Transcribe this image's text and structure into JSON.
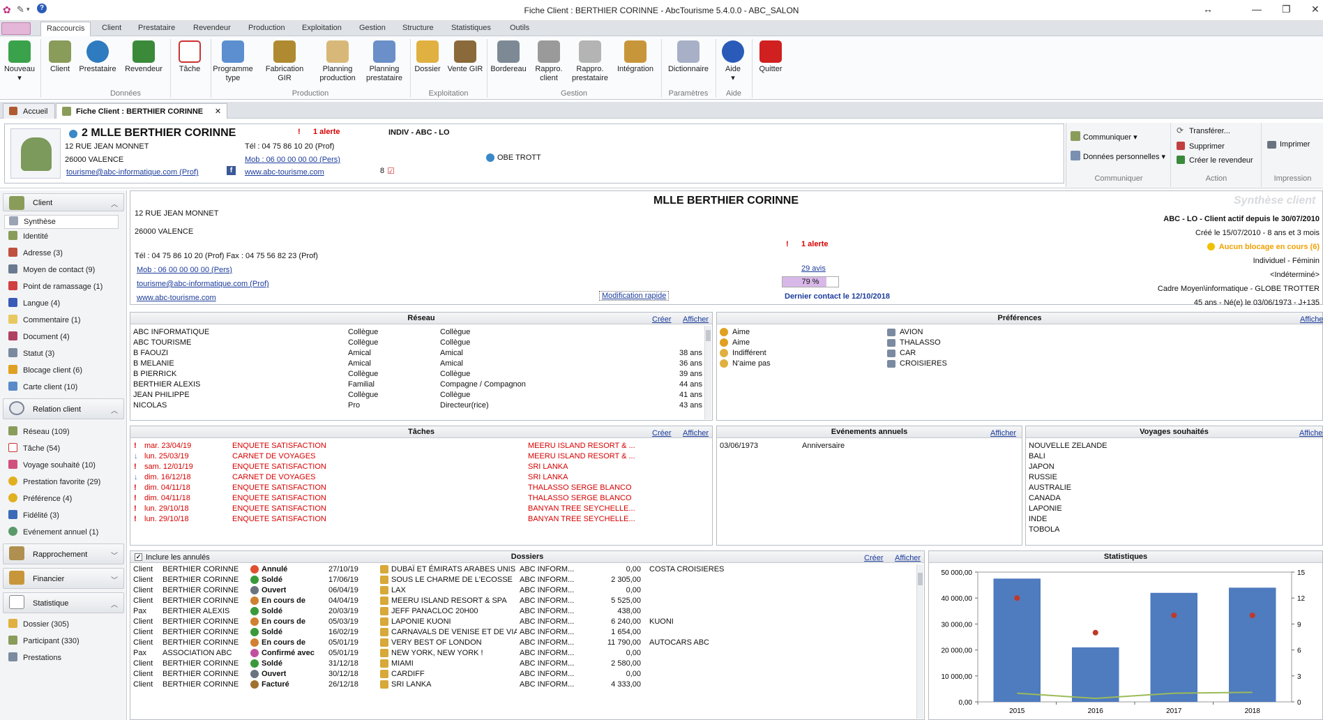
{
  "window": {
    "title": "Fiche Client : BERTHIER CORINNE - AbcTourisme 5.4.0.0 - ABC_SALON"
  },
  "ribbon_tabs": [
    "Raccourcis",
    "Client",
    "Prestataire",
    "Revendeur",
    "Production",
    "Exploitation",
    "Gestion",
    "Structure",
    "Statistiques",
    "Outils"
  ],
  "ribbon": {
    "buttons": [
      "Nouveau",
      "Client",
      "Prestataire",
      "Revendeur",
      "Tâche",
      "Programme type",
      "Fabrication GIR",
      "Planning production",
      "Planning prestataire",
      "Dossier",
      "Vente GIR",
      "Bordereau",
      "Rappro. client",
      "Rappro. prestataire",
      "Intégration",
      "Dictionnaire",
      "Aide",
      "Quitter"
    ],
    "groups": [
      "Données",
      "Production",
      "Exploitation",
      "Gestion",
      "Paramètres",
      "Aide"
    ]
  },
  "doc_tabs": {
    "home": "Accueil",
    "active": "Fiche Client : BERTHIER CORINNE",
    "close": "✕"
  },
  "header": {
    "name": "2 MLLE BERTHIER CORINNE",
    "alert": "1 alerte",
    "category": "INDIV - ABC - LO",
    "address1": "12 RUE JEAN MONNET",
    "address2": "26000 VALENCE",
    "email": "tourisme@abc-informatique.com (Prof)",
    "tel": "Tél : 04 75 86 10 20  (Prof)",
    "mob": "Mob : 06 00 00 00 00  (Pers)",
    "web": "www.abc-tourisme.com",
    "count": "8",
    "globe": "OBE TROTT"
  },
  "right_actions": {
    "communiquer": [
      "Communiquer ▾",
      "Données personnelles ▾"
    ],
    "communiquer_label": "Communiquer",
    "action": [
      "Transférer...",
      "Supprimer",
      "Créer le revendeur"
    ],
    "action_label": "Action",
    "impression": [
      "Imprimer"
    ],
    "impression_label": "Impression"
  },
  "sidebar": {
    "client_head": "Client",
    "client_items": [
      "Synthèse",
      "Identité",
      "Adresse (3)",
      "Moyen de contact (9)",
      "Point de ramassage (1)",
      "Langue (4)",
      "Commentaire (1)",
      "Document (4)",
      "Statut (3)",
      "Blocage client (6)",
      "Carte client (10)"
    ],
    "relation_head": "Relation client",
    "relation_items": [
      "Réseau (109)",
      "Tâche (54)",
      "Voyage souhaité (10)",
      "Prestation favorite (29)",
      "Préférence (4)",
      "Fidélité (3)",
      "Evénement annuel (1)"
    ],
    "rapprochement_head": "Rapprochement",
    "financier_head": "Financier",
    "statistique_head": "Statistique",
    "statistique_items": [
      "Dossier (305)",
      "Participant (330)",
      "Prestations"
    ]
  },
  "synthese": {
    "title": "MLLE BERTHIER CORINNE",
    "watermark": "Synthèse client",
    "addr1": "12 RUE JEAN MONNET",
    "addr2": "26000 VALENCE",
    "telfax": "Tél : 04 75 86 10 20  (Prof)    Fax : 04 75 56 82 23 (Prof)",
    "mob": "Mob : 06 00 00 00 00  (Pers)",
    "email": "tourisme@abc-informatique.com (Prof)",
    "web": "www.abc-tourisme.com",
    "modif": "Modification rapide",
    "alert": "1 alerte",
    "avis": "29 avis",
    "percent": "79 %",
    "percent_value": 79,
    "last_contact": "Dernier contact le 12/10/2018",
    "r1": "ABC - LO - Client actif depuis le 30/07/2010",
    "r2": "Créé le 15/07/2010 - 8 ans  et 3 mois",
    "r3": "Aucun blocage en cours (6)",
    "r4": "Individuel - Féminin",
    "r5": "<Indéterminé>",
    "r6": "Cadre Moyen\\informatique - GLOBE TROTTER",
    "r7": "45 ans - Né(e) le 03/06/1973 -  J+135"
  },
  "reseau": {
    "title": "Réseau",
    "creer": "Créer",
    "afficher": "Afficher",
    "rows": [
      [
        "ABC INFORMATIQUE",
        "Collègue",
        "Collègue",
        ""
      ],
      [
        "ABC TOURISME",
        "Collègue",
        "Collègue",
        ""
      ],
      [
        "B FAOUZI",
        "Amical",
        "Amical",
        "38 ans"
      ],
      [
        "B MELANIE",
        "Amical",
        "Amical",
        "36 ans"
      ],
      [
        "B PIERRICK",
        "Collègue",
        "Collègue",
        "39 ans"
      ],
      [
        "BERTHIER ALEXIS",
        "Familial",
        "Compagne / Compagnon",
        "44 ans"
      ],
      [
        "JEAN PHILIPPE",
        "Collègue",
        "Collègue",
        "41 ans"
      ],
      [
        "NICOLAS",
        "Pro",
        "Directeur(rice)",
        "43 ans"
      ]
    ]
  },
  "preferences": {
    "title": "Préférences",
    "afficher": "Afficher",
    "rows": [
      [
        "Aime",
        "AVION"
      ],
      [
        "Aime",
        "THALASSO"
      ],
      [
        "Indifférent",
        "CAR"
      ],
      [
        "N'aime pas",
        "CROISIERES"
      ]
    ]
  },
  "taches": {
    "title": "Tâches",
    "creer": "Créer",
    "afficher": "Afficher",
    "rows": [
      [
        "mar. 23/04/19",
        "ENQUETE SATISFACTION",
        "MEERU ISLAND RESORT & ..."
      ],
      [
        "lun. 25/03/19",
        "CARNET DE VOYAGES",
        "MEERU ISLAND RESORT & ..."
      ],
      [
        "sam. 12/01/19",
        "ENQUETE SATISFACTION",
        "SRI LANKA"
      ],
      [
        "dim. 16/12/18",
        "CARNET DE VOYAGES",
        "SRI LANKA"
      ],
      [
        "dim. 04/11/18",
        "ENQUETE SATISFACTION",
        "THALASSO SERGE BLANCO"
      ],
      [
        "dim. 04/11/18",
        "ENQUETE SATISFACTION",
        "THALASSO SERGE BLANCO"
      ],
      [
        "lun. 29/10/18",
        "ENQUETE SATISFACTION",
        "BANYAN TREE SEYCHELLE..."
      ],
      [
        "lun. 29/10/18",
        "ENQUETE SATISFACTION",
        "BANYAN TREE SEYCHELLE..."
      ]
    ]
  },
  "evenements": {
    "title": "Evénements annuels",
    "afficher": "Afficher",
    "rows": [
      [
        "03/06/1973",
        "Anniversaire"
      ]
    ]
  },
  "voyages": {
    "title": "Voyages souhaités",
    "afficher": "Afficher",
    "rows": [
      "NOUVELLE ZELANDE",
      "BALI",
      "JAPON",
      "RUSSIE",
      "AUSTRALIE",
      "CANADA",
      "LAPONIE",
      "INDE",
      "TOBOLA"
    ]
  },
  "dossiers": {
    "title": "Dossiers",
    "include": "Inclure les annulés",
    "creer": "Créer",
    "afficher": "Afficher",
    "rows": [
      [
        "Client",
        "BERTHIER CORINNE",
        "Annulé",
        "27/10/19",
        "DUBAÏ ET ÉMIRATS ARABES UNIS",
        "ABC INFORM...",
        "0,00",
        "COSTA CROISIERES"
      ],
      [
        "Client",
        "BERTHIER CORINNE",
        "Soldé",
        "17/06/19",
        "SOUS LE CHARME DE L'ECOSSE",
        "ABC INFORM...",
        "2 305,00",
        ""
      ],
      [
        "Client",
        "BERTHIER CORINNE",
        "Ouvert",
        "06/04/19",
        "LAX",
        "ABC INFORM...",
        "0,00",
        ""
      ],
      [
        "Client",
        "BERTHIER CORINNE",
        "En cours de",
        "04/04/19",
        "MEERU ISLAND RESORT & SPA",
        "ABC INFORM...",
        "5 525,00",
        ""
      ],
      [
        "Pax",
        "BERTHIER ALEXIS",
        "Soldé",
        "20/03/19",
        "JEFF PANACLOC 20H00",
        "ABC INFORM...",
        "438,00",
        ""
      ],
      [
        "Client",
        "BERTHIER CORINNE",
        "En cours de",
        "05/03/19",
        "LAPONIE KUONI",
        "ABC INFORM...",
        "6 240,00",
        "KUONI"
      ],
      [
        "Client",
        "BERTHIER CORINNE",
        "Soldé",
        "16/02/19",
        "CARNAVALS DE VENISE ET DE VIAREGGIO",
        "ABC INFORM...",
        "1 654,00",
        ""
      ],
      [
        "Client",
        "BERTHIER CORINNE",
        "En cours de",
        "05/01/19",
        "VERY BEST OF LONDON",
        "ABC INFORM...",
        "11 790,00",
        "AUTOCARS ABC"
      ],
      [
        "Pax",
        "ASSOCIATION ABC",
        "Confirmé avec",
        "05/01/19",
        "NEW YORK, NEW YORK !",
        "ABC INFORM...",
        "0,00",
        ""
      ],
      [
        "Client",
        "BERTHIER CORINNE",
        "Soldé",
        "31/12/18",
        "MIAMI",
        "ABC INFORM...",
        "2 580,00",
        ""
      ],
      [
        "Client",
        "BERTHIER CORINNE",
        "Ouvert",
        "30/12/18",
        "CARDIFF",
        "ABC INFORM...",
        "0,00",
        ""
      ],
      [
        "Client",
        "BERTHIER CORINNE",
        "Facturé",
        "26/12/18",
        "SRI LANKA",
        "ABC INFORM...",
        "4 333,00",
        ""
      ]
    ]
  },
  "statistiques": {
    "title": "Statistiques"
  },
  "chart_data": {
    "type": "bar",
    "categories": [
      "2015",
      "2016",
      "2017",
      "2018"
    ],
    "ylim": [
      0,
      50000
    ],
    "yticks": [
      "0,00",
      "10 000,00",
      "20 000,00",
      "30 000,00",
      "40 000,00",
      "50 000,00"
    ],
    "y2ticks": [
      "0",
      "3",
      "6",
      "9",
      "12",
      "15"
    ],
    "series": [
      {
        "kind": "bar",
        "values": [
          47500,
          21000,
          42000,
          44000
        ],
        "color": "#4f7bbf"
      },
      {
        "kind": "scatter",
        "values": [
          12,
          8,
          10,
          10
        ],
        "color": "#c0392b"
      },
      {
        "kind": "line",
        "values": [
          1,
          0.4,
          1,
          1.1
        ],
        "color": "#9bbb59"
      }
    ],
    "y2lim": [
      0,
      15
    ]
  },
  "colors": {
    "accent": "#1c3c9c",
    "alert": "#d80000",
    "orange": "#f0a000",
    "bar": "#4f7bbf"
  }
}
